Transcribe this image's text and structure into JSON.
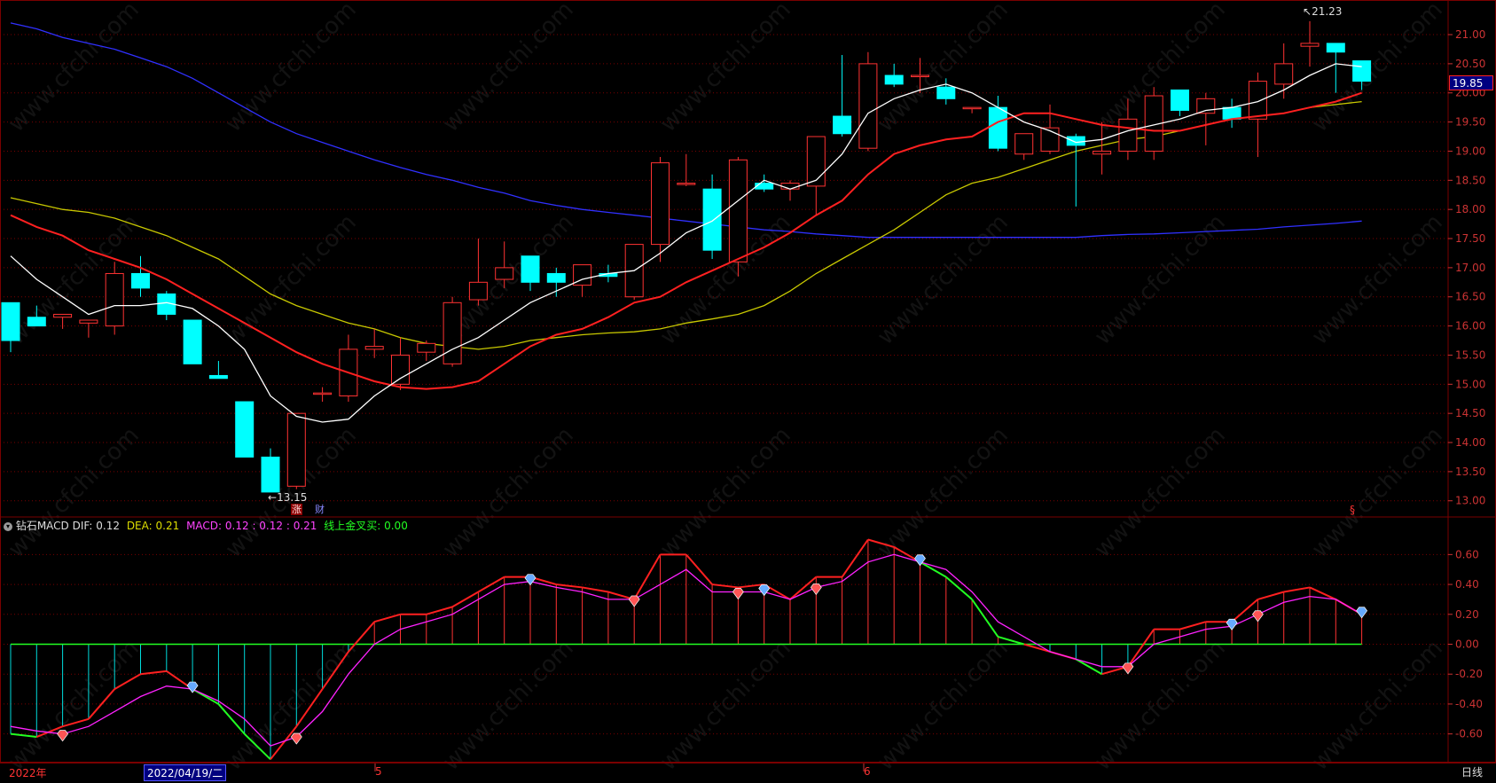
{
  "colors": {
    "up": "#ff3232",
    "down": "#00ffff",
    "ma5": "#ffffff",
    "ma10": "#ff2020",
    "ma20": "#c8c800",
    "ma60": "#3030ff",
    "grid": "#7a0000",
    "axis_text": "#cc3333",
    "dif": "#ff2020",
    "dea": "#ff22ff",
    "cross_line": "#22ff22",
    "macd_pos": "#ff3232",
    "macd_neg": "#00dddd",
    "price_tag_bg": "#000080"
  },
  "price_axis": {
    "ticks": [
      "21.00",
      "20.50",
      "20.00",
      "19.50",
      "19.00",
      "18.50",
      "18.00",
      "17.50",
      "17.00",
      "16.50",
      "16.00",
      "15.50",
      "15.00",
      "14.50",
      "14.00",
      "13.50",
      "13.00"
    ],
    "current_price": "19.85",
    "high_label": "21.23",
    "low_label": "13.15",
    "marker_zhang": "涨",
    "marker_cai": "财",
    "marker_s": "§"
  },
  "indicator": {
    "name": "钻石MACD",
    "dif_label": "DIF:",
    "dif_value": "0.12",
    "dea_label": "DEA:",
    "dea_value": "0.21",
    "macd_label": "MACD:",
    "macd_value": "0.12 : 0.12 : 0.21",
    "cross_label": "线上金叉买:",
    "cross_value": "0.00",
    "ticks": [
      "0.60",
      "0.40",
      "0.20",
      "0.00",
      "-0.20",
      "-0.40",
      "-0.60"
    ]
  },
  "date_axis": {
    "year_label": "2022年",
    "cursor_date": "2022/04/19/二",
    "month_5": "5",
    "month_6": "6",
    "period_button": "日线"
  },
  "watermark": "www.cfchi.com",
  "chart_data": [
    {
      "type": "candlestick",
      "title": "",
      "ylim": [
        12.8,
        21.2
      ],
      "ohlc": [
        [
          16.4,
          16.4,
          15.55,
          15.75
        ],
        [
          16.15,
          16.35,
          16.0,
          16.0
        ],
        [
          16.15,
          16.2,
          15.95,
          16.2
        ],
        [
          16.05,
          16.1,
          15.8,
          16.1
        ],
        [
          16.0,
          17.1,
          15.85,
          16.9
        ],
        [
          16.9,
          17.2,
          16.5,
          16.65
        ],
        [
          16.55,
          16.6,
          16.1,
          16.2
        ],
        [
          16.1,
          16.1,
          15.35,
          15.35
        ],
        [
          15.15,
          15.4,
          15.1,
          15.1
        ],
        [
          14.7,
          14.7,
          13.75,
          13.75
        ],
        [
          13.75,
          13.9,
          13.15,
          13.15
        ],
        [
          13.25,
          14.5,
          13.2,
          14.5
        ],
        [
          14.85,
          14.95,
          14.7,
          14.85
        ],
        [
          14.8,
          15.85,
          14.7,
          15.6
        ],
        [
          15.6,
          15.95,
          15.45,
          15.65
        ],
        [
          15.0,
          15.8,
          14.9,
          15.5
        ],
        [
          15.55,
          15.75,
          15.4,
          15.7
        ],
        [
          15.35,
          16.5,
          15.3,
          16.4
        ],
        [
          16.45,
          17.5,
          16.35,
          16.75
        ],
        [
          16.8,
          17.45,
          16.65,
          17.0
        ],
        [
          17.2,
          17.2,
          16.6,
          16.75
        ],
        [
          16.9,
          17.0,
          16.5,
          16.75
        ],
        [
          16.7,
          17.05,
          16.5,
          17.05
        ],
        [
          16.9,
          17.05,
          16.75,
          16.85
        ],
        [
          16.5,
          17.4,
          16.45,
          17.4
        ],
        [
          17.4,
          18.9,
          17.1,
          18.8
        ],
        [
          18.45,
          18.95,
          18.4,
          18.45
        ],
        [
          18.35,
          18.6,
          17.15,
          17.3
        ],
        [
          17.1,
          18.9,
          16.85,
          18.85
        ],
        [
          18.45,
          18.6,
          18.3,
          18.35
        ],
        [
          18.35,
          18.5,
          18.15,
          18.45
        ],
        [
          18.4,
          19.25,
          17.9,
          19.25
        ],
        [
          19.6,
          20.65,
          19.25,
          19.3
        ],
        [
          19.05,
          20.7,
          19.0,
          20.5
        ],
        [
          20.3,
          20.5,
          20.1,
          20.15
        ],
        [
          20.3,
          20.6,
          20.0,
          20.3
        ],
        [
          20.1,
          20.25,
          19.8,
          19.9
        ],
        [
          19.75,
          19.75,
          19.65,
          19.75
        ],
        [
          19.75,
          19.95,
          19.0,
          19.05
        ],
        [
          18.95,
          19.3,
          18.85,
          19.3
        ],
        [
          19.0,
          19.8,
          18.95,
          19.4
        ],
        [
          19.25,
          19.3,
          18.05,
          19.1
        ],
        [
          18.95,
          19.5,
          18.6,
          19.0
        ],
        [
          19.0,
          19.9,
          18.85,
          19.55
        ],
        [
          19.0,
          20.1,
          18.85,
          19.95
        ],
        [
          20.05,
          20.05,
          19.6,
          19.7
        ],
        [
          19.65,
          20.0,
          19.1,
          19.9
        ],
        [
          19.75,
          19.9,
          19.4,
          19.55
        ],
        [
          19.55,
          20.35,
          18.9,
          20.2
        ],
        [
          20.15,
          20.85,
          19.9,
          20.5
        ],
        [
          20.8,
          21.23,
          20.45,
          20.85
        ],
        [
          20.85,
          20.85,
          20.0,
          20.7
        ],
        [
          20.55,
          20.55,
          20.05,
          20.2
        ]
      ],
      "ma5": [
        17.2,
        16.8,
        16.5,
        16.2,
        16.35,
        16.35,
        16.4,
        16.3,
        16.0,
        15.6,
        14.8,
        14.45,
        14.35,
        14.4,
        14.8,
        15.1,
        15.35,
        15.6,
        15.8,
        16.1,
        16.4,
        16.6,
        16.8,
        16.9,
        16.95,
        17.25,
        17.6,
        17.8,
        18.15,
        18.5,
        18.35,
        18.5,
        18.95,
        19.65,
        19.9,
        20.05,
        20.15,
        20.0,
        19.75,
        19.5,
        19.35,
        19.15,
        19.2,
        19.35,
        19.45,
        19.55,
        19.7,
        19.75,
        19.85,
        20.05,
        20.3,
        20.5,
        20.45
      ],
      "ma10": [
        17.9,
        17.7,
        17.55,
        17.3,
        17.15,
        17.0,
        16.8,
        16.55,
        16.3,
        16.05,
        15.8,
        15.55,
        15.35,
        15.2,
        15.05,
        14.95,
        14.92,
        14.95,
        15.05,
        15.35,
        15.65,
        15.85,
        15.95,
        16.15,
        16.4,
        16.5,
        16.75,
        16.95,
        17.15,
        17.35,
        17.6,
        17.9,
        18.15,
        18.6,
        18.95,
        19.1,
        19.2,
        19.25,
        19.5,
        19.65,
        19.65,
        19.55,
        19.45,
        19.4,
        19.35,
        19.35,
        19.45,
        19.55,
        19.6,
        19.65,
        19.75,
        19.85,
        20.0
      ],
      "ma20": [
        18.2,
        18.1,
        18.0,
        17.95,
        17.85,
        17.7,
        17.55,
        17.35,
        17.15,
        16.85,
        16.55,
        16.35,
        16.2,
        16.05,
        15.95,
        15.8,
        15.7,
        15.65,
        15.6,
        15.65,
        15.75,
        15.8,
        15.85,
        15.88,
        15.9,
        15.95,
        16.05,
        16.12,
        16.2,
        16.35,
        16.6,
        16.9,
        17.15,
        17.4,
        17.65,
        17.95,
        18.25,
        18.45,
        18.55,
        18.7,
        18.85,
        19.0,
        19.1,
        19.2,
        19.25,
        19.35,
        19.45,
        19.55,
        19.6,
        19.65,
        19.75,
        19.8,
        19.85
      ],
      "ma60": [
        21.2,
        21.1,
        20.95,
        20.85,
        20.75,
        20.6,
        20.45,
        20.25,
        20.0,
        19.75,
        19.5,
        19.3,
        19.15,
        19.0,
        18.85,
        18.72,
        18.6,
        18.5,
        18.38,
        18.28,
        18.15,
        18.07,
        18.0,
        17.95,
        17.9,
        17.85,
        17.8,
        17.75,
        17.7,
        17.65,
        17.62,
        17.58,
        17.55,
        17.52,
        17.52,
        17.52,
        17.52,
        17.52,
        17.52,
        17.52,
        17.52,
        17.52,
        17.55,
        17.57,
        17.58,
        17.6,
        17.62,
        17.64,
        17.66,
        17.7,
        17.73,
        17.76,
        17.8
      ]
    },
    {
      "type": "line",
      "title": "钻石MACD",
      "ylim": [
        -0.75,
        0.75
      ],
      "series": [
        {
          "name": "DIF",
          "values": [
            -0.6,
            -0.62,
            -0.55,
            -0.5,
            -0.3,
            -0.2,
            -0.18,
            -0.3,
            -0.4,
            -0.6,
            -0.77,
            -0.55,
            -0.3,
            -0.05,
            0.15,
            0.2,
            0.2,
            0.25,
            0.35,
            0.45,
            0.45,
            0.4,
            0.38,
            0.35,
            0.3,
            0.6,
            0.6,
            0.4,
            0.38,
            0.4,
            0.3,
            0.45,
            0.45,
            0.7,
            0.65,
            0.55,
            0.45,
            0.3,
            0.05,
            0.0,
            -0.05,
            -0.1,
            -0.2,
            -0.15,
            0.1,
            0.1,
            0.15,
            0.15,
            0.3,
            0.35,
            0.38,
            0.3,
            0.2
          ]
        },
        {
          "name": "DEA",
          "values": [
            -0.55,
            -0.58,
            -0.6,
            -0.55,
            -0.45,
            -0.35,
            -0.28,
            -0.3,
            -0.38,
            -0.5,
            -0.68,
            -0.62,
            -0.45,
            -0.2,
            0.0,
            0.1,
            0.15,
            0.2,
            0.3,
            0.4,
            0.42,
            0.38,
            0.35,
            0.3,
            0.3,
            0.4,
            0.5,
            0.35,
            0.35,
            0.35,
            0.3,
            0.38,
            0.42,
            0.55,
            0.6,
            0.55,
            0.5,
            0.35,
            0.15,
            0.05,
            -0.05,
            -0.1,
            -0.15,
            -0.15,
            0.0,
            0.05,
            0.1,
            0.12,
            0.2,
            0.28,
            0.32,
            0.3,
            0.2
          ]
        },
        {
          "name": "MACD",
          "values": [
            -0.6,
            -0.62,
            -0.55,
            -0.5,
            -0.3,
            -0.2,
            -0.18,
            -0.3,
            -0.4,
            -0.6,
            -0.77,
            -0.55,
            -0.3,
            -0.05,
            0.15,
            0.2,
            0.2,
            0.25,
            0.35,
            0.45,
            0.45,
            0.4,
            0.38,
            0.35,
            0.3,
            0.6,
            0.6,
            0.4,
            0.38,
            0.4,
            0.3,
            0.45,
            0.45,
            0.7,
            0.65,
            0.55,
            0.45,
            0.3,
            0.05,
            0.0,
            -0.05,
            -0.1,
            -0.2,
            -0.15,
            0.1,
            0.1,
            0.15,
            0.15,
            0.3,
            0.35,
            0.38,
            0.3,
            0.2
          ]
        }
      ],
      "buy_diamonds": [
        2,
        11,
        24,
        28,
        31,
        43,
        48
      ],
      "sell_diamonds": [
        7,
        20,
        29,
        35,
        47,
        52
      ]
    }
  ]
}
